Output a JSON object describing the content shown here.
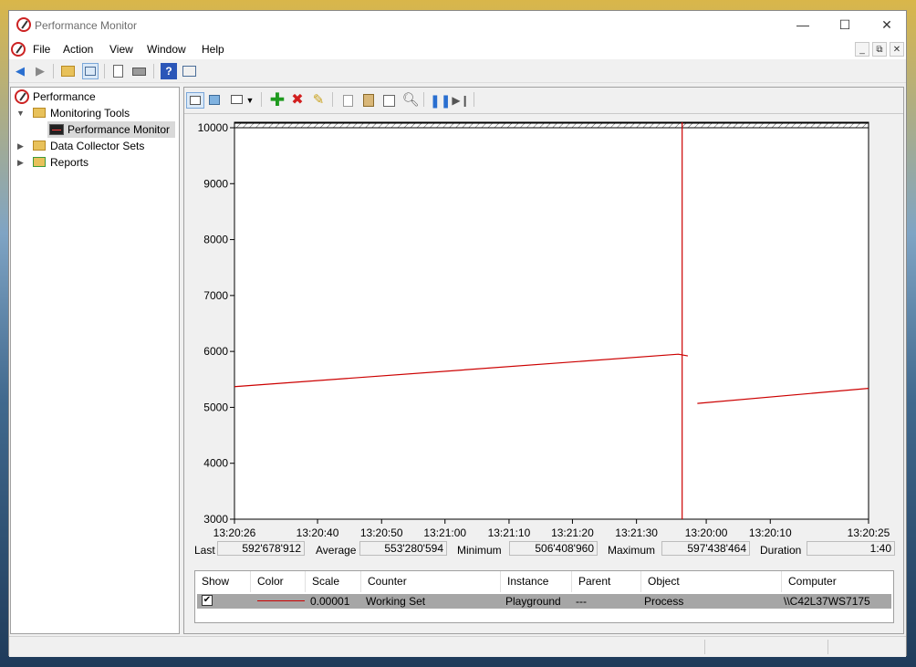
{
  "window": {
    "title": "Performance Monitor",
    "minimize": "—",
    "maximize": "☐",
    "close": "✕"
  },
  "menu": [
    "File",
    "Action",
    "View",
    "Window",
    "Help"
  ],
  "mdi": {
    "minimize": "_",
    "restore": "⧉",
    "close": "✕"
  },
  "tree": {
    "root": "Performance",
    "monitoring_tools": "Monitoring Tools",
    "performance_monitor": "Performance Monitor",
    "data_collector_sets": "Data Collector Sets",
    "reports": "Reports"
  },
  "stats": {
    "last_label": "Last",
    "last_value": "592'678'912",
    "average_label": "Average",
    "average_value": "553'280'594",
    "minimum_label": "Minimum",
    "minimum_value": "506'408'960",
    "maximum_label": "Maximum",
    "maximum_value": "597'438'464",
    "duration_label": "Duration",
    "duration_value": "1:40"
  },
  "legend": {
    "headers": [
      "Show",
      "Color",
      "Scale",
      "Counter",
      "Instance",
      "Parent",
      "Object",
      "Computer"
    ],
    "row": {
      "show": "✔",
      "scale": "0.00001",
      "counter": "Working Set",
      "instance": "Playground",
      "parent": "---",
      "object": "Process",
      "computer": "\\\\C42L37WS7175"
    },
    "line_color": "#cc0000"
  },
  "chart_data": {
    "type": "line",
    "y_ticks": [
      "10000",
      "9000",
      "8000",
      "7000",
      "6000",
      "5000",
      "4000",
      "3000"
    ],
    "ylim": [
      3000,
      10000
    ],
    "x_ticks": [
      "13:20:26",
      "13:20:40",
      "13:20:50",
      "13:21:00",
      "13:21:10",
      "13:21:20",
      "13:21:30",
      "13:20:00",
      "13:20:10",
      "13:20:25"
    ],
    "series": [
      {
        "color": "#cc0000",
        "segments": [
          [
            [
              0,
              5370
            ],
            [
              70,
              5950
            ],
            [
              71.5,
              5920
            ]
          ],
          [
            [
              73,
              5070
            ],
            [
              100,
              5340
            ]
          ]
        ]
      }
    ],
    "current_time_marker": 70.6,
    "grid": false
  }
}
